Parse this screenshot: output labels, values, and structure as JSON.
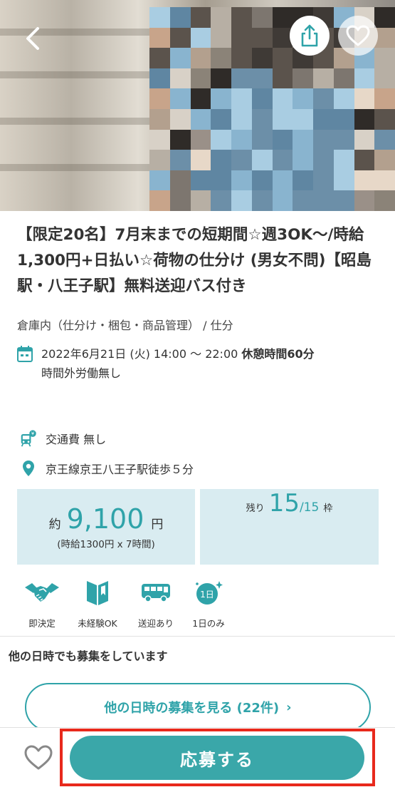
{
  "header": {
    "back_icon": "chevron-left-icon",
    "share_icon": "share-icon",
    "favorite_icon": "heart-icon"
  },
  "job": {
    "title": "【限定20名】7月末までの短期間☆週3OK〜/時給1,300円+日払い☆荷物の仕分け (男女不問)【昭島駅・八王子駅】無料送迎バス付き",
    "category": "倉庫内（仕分け・梱包・商品管理） / 仕分",
    "date": "2022年6月21日 (火) 14:00 〜 22:00",
    "break": "休憩時間60分",
    "overtime": "時間外労働無し",
    "transport_fee": "交通費 無し",
    "access": "京王線京王八王子駅徒歩５分"
  },
  "pay": {
    "prefix": "約",
    "amount": "9,100",
    "unit": "円",
    "detail": "(時給1300円 x 7時間)"
  },
  "slots": {
    "label": "残り",
    "remaining": "15",
    "total": "/15",
    "unit": "枠"
  },
  "features": [
    {
      "label": "即決定",
      "icon": "handshake-icon"
    },
    {
      "label": "未経験OK",
      "icon": "book-icon"
    },
    {
      "label": "送迎あり",
      "icon": "bus-icon"
    },
    {
      "label": "1日のみ",
      "icon": "one-day-icon"
    }
  ],
  "one_day_badge": "1日",
  "other_dates": {
    "heading": "他の日時でも募集をしています",
    "button_label": "他の日時の募集を見る (22件)",
    "chevron": "›"
  },
  "footer": {
    "apply_label": "応募する",
    "favorite_icon": "heart-outline-icon"
  },
  "colors": {
    "accent": "#2fa3a9",
    "info_box_bg": "#d9ecf1",
    "highlight": "#e8291c"
  }
}
